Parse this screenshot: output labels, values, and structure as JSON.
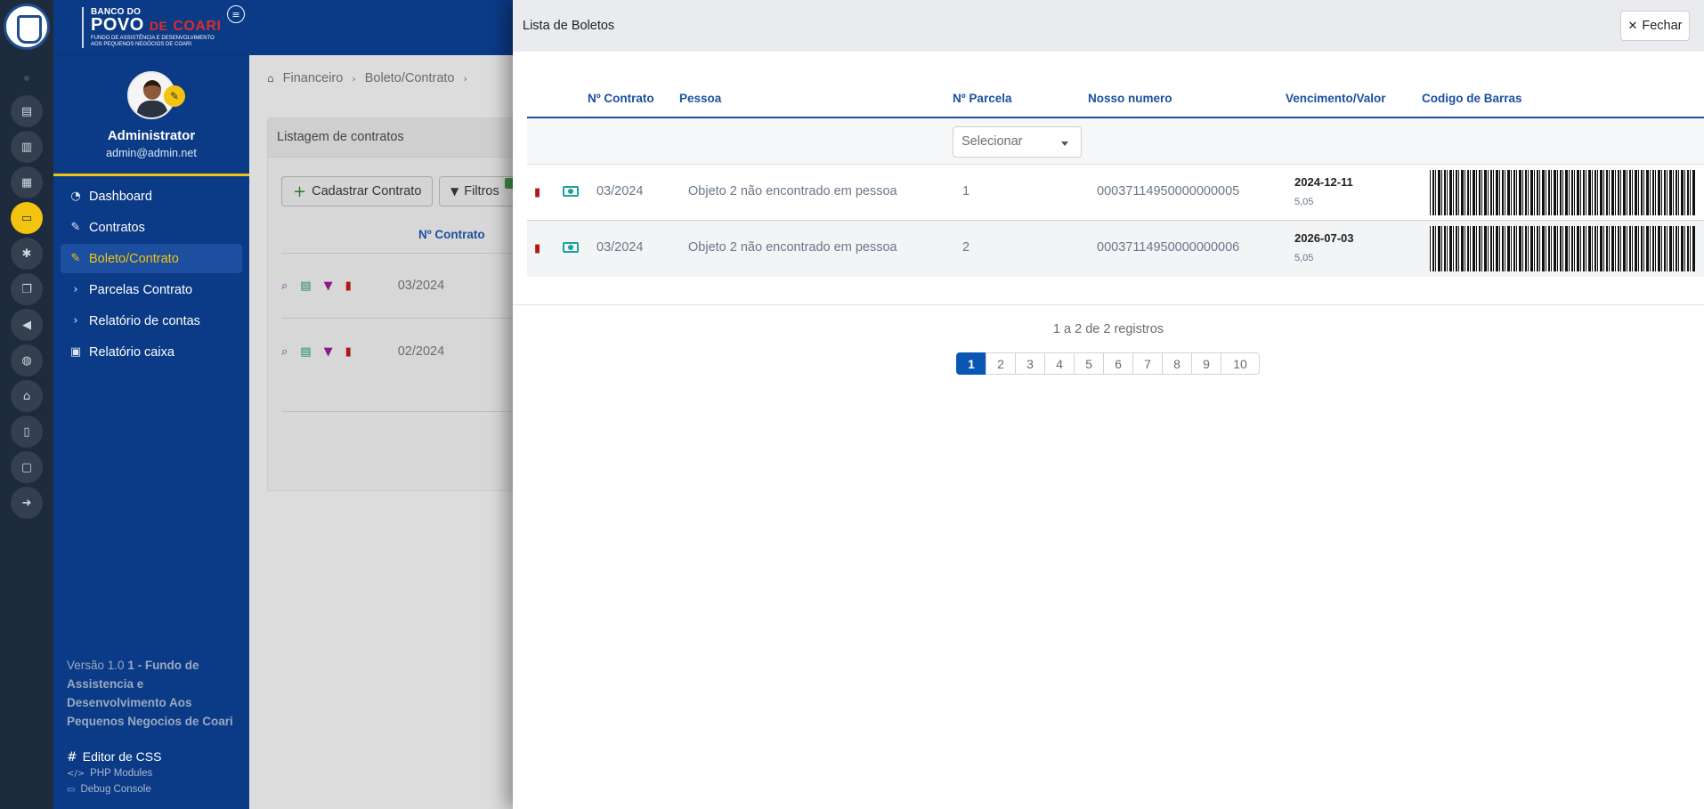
{
  "brand": {
    "line1": "BANCO DO",
    "line2_povo": "POVO",
    "line2_de": "DE",
    "line2_coari": "COARI",
    "line3": "FUNDO DE ASSISTÊNCIA E DESENVOLVIMENTO AOS PEQUENOS NEGÓCIOS DE COARI"
  },
  "rail": {
    "icons": [
      "id-card-icon",
      "clipboard-icon",
      "calendar-icon",
      "money-icon",
      "cogs-icon",
      "copy-icon",
      "bullhorn-icon",
      "globe-icon",
      "home-icon",
      "file-icon",
      "monitor-icon",
      "sign-out-icon"
    ],
    "active_index": 3
  },
  "profile": {
    "name": "Administrator",
    "email": "admin@admin.net"
  },
  "nav": [
    {
      "label": "Dashboard",
      "icon": "dashboard-icon"
    },
    {
      "label": "Contratos",
      "icon": "edit-icon"
    },
    {
      "label": "Boleto/Contrato",
      "icon": "edit-icon",
      "active": true
    },
    {
      "label": "Parcelas Contrato",
      "icon": "chevron-right-icon"
    },
    {
      "label": "Relatório de contas",
      "icon": "chevron-right-icon"
    },
    {
      "label": "Relatório caixa",
      "icon": "cash-register-icon"
    }
  ],
  "footer": {
    "version_prefix": "Versão 1.0",
    "version_bold": "1 - Fundo de Assistencia e Desenvolvimento Aos Pequenos Negocios de Coari",
    "css_editor": "Editor de CSS",
    "php_modules": "PHP Modules",
    "debug_console": "Debug Console"
  },
  "breadcrumb": [
    "Financeiro",
    "Boleto/Contrato"
  ],
  "background": {
    "card_title": "Listagem de contratos",
    "add_button": "Cadastrar Contrato",
    "filter_button": "Filtros",
    "column_contract": "Nº Contrato",
    "rows": [
      "03/2024",
      "02/2024"
    ]
  },
  "modal": {
    "title": "Lista de Boletos",
    "close_label": "Fechar",
    "columns": {
      "contract": "Nº Contrato",
      "person": "Pessoa",
      "installment": "Nº Parcela",
      "our_number": "Nosso numero",
      "due_value": "Vencimento/Valor",
      "barcode": "Codigo de Barras"
    },
    "filter_placeholder": "Selecionar",
    "rows": [
      {
        "contract": "03/2024",
        "person": "Objeto 2 não encontrado em pessoa",
        "installment": "1",
        "our_number": "00037114950000000005",
        "due": "2024-12-11",
        "value": "5,05"
      },
      {
        "contract": "03/2024",
        "person": "Objeto 2 não encontrado em pessoa",
        "installment": "2",
        "our_number": "00037114950000000006",
        "due": "2026-07-03",
        "value": "5,05"
      }
    ],
    "records_text": "1 a 2 de 2 registros",
    "pages": [
      "1",
      "2",
      "3",
      "4",
      "5",
      "6",
      "7",
      "8",
      "9",
      "10"
    ],
    "active_page": "1"
  },
  "colors": {
    "brand_blue": "#0b3a86",
    "accent_yellow": "#f2c40f",
    "header_blue": "#1c4f9f",
    "pdf_red": "#b01818",
    "money_teal": "#1aa39a"
  }
}
